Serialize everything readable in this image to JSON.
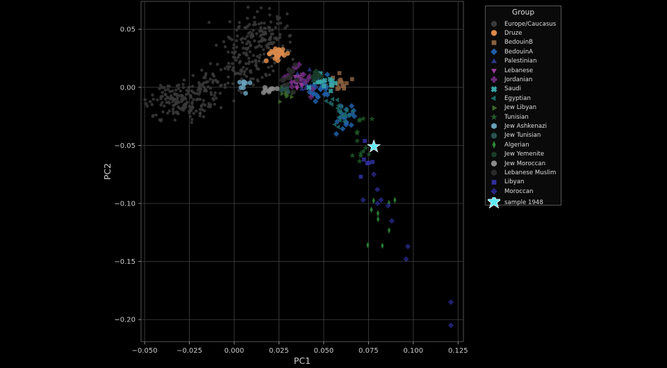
{
  "chart_data": {
    "type": "scatter",
    "xlabel": "PC1",
    "ylabel": "PC2",
    "xlim": [
      -0.052,
      0.128
    ],
    "ylim": [
      -0.219,
      0.074
    ],
    "xticks": [
      -0.05,
      -0.025,
      0.0,
      0.025,
      0.05,
      0.075,
      0.1,
      0.125
    ],
    "xtick_labels": [
      "−0.050",
      "−0.025",
      "0.000",
      "0.025",
      "0.050",
      "0.075",
      "0.100",
      "0.125"
    ],
    "yticks": [
      0.05,
      0.0,
      -0.05,
      -0.1,
      -0.15,
      -0.2
    ],
    "ytick_labels": [
      "0.05",
      "0.00",
      "−0.05",
      "−0.10",
      "−0.15",
      "−0.20"
    ],
    "grid": true,
    "legend": {
      "title": "Group",
      "placement": "outside-right"
    },
    "series": [
      {
        "name": "Europe/Caucasus",
        "marker": "circle",
        "color": "#3a3a3a",
        "clusters": [
          {
            "cx": 0.01,
            "cy": 0.04,
            "sx": 0.009,
            "sy": 0.012,
            "n": 140
          },
          {
            "cx": -0.03,
            "cy": -0.012,
            "sx": 0.011,
            "sy": 0.007,
            "n": 170
          },
          {
            "cx": -0.012,
            "cy": 0.002,
            "sx": 0.006,
            "sy": 0.008,
            "n": 50
          },
          {
            "cx": 0.005,
            "cy": 0.015,
            "sx": 0.006,
            "sy": 0.01,
            "n": 50
          },
          {
            "cx": 0.02,
            "cy": 0.045,
            "sx": 0.004,
            "sy": 0.008,
            "n": 30
          }
        ]
      },
      {
        "name": "Druze",
        "marker": "circle",
        "color": "#d98a4a",
        "clusters": [
          {
            "cx": 0.024,
            "cy": 0.029,
            "sx": 0.0025,
            "sy": 0.003,
            "n": 28
          }
        ]
      },
      {
        "name": "BedouinB",
        "marker": "square",
        "color": "#8a6040",
        "clusters": [
          {
            "cx": 0.059,
            "cy": 0.003,
            "sx": 0.003,
            "sy": 0.003,
            "n": 16
          }
        ]
      },
      {
        "name": "BedouinA",
        "marker": "diamond",
        "color": "#1f5fa8",
        "clusters": [
          {
            "cx": 0.046,
            "cy": -0.002,
            "sx": 0.004,
            "sy": 0.006,
            "n": 30
          },
          {
            "cx": 0.062,
            "cy": -0.026,
            "sx": 0.004,
            "sy": 0.006,
            "n": 18
          }
        ]
      },
      {
        "name": "Palestinian",
        "marker": "triangle-up",
        "color": "#2d3a8c",
        "clusters": [
          {
            "cx": 0.04,
            "cy": 0.004,
            "sx": 0.004,
            "sy": 0.004,
            "n": 18
          }
        ]
      },
      {
        "name": "Lebanese",
        "marker": "triangle-down",
        "color": "#9b3d9b",
        "clusters": [
          {
            "cx": 0.035,
            "cy": 0.006,
            "sx": 0.003,
            "sy": 0.004,
            "n": 14
          }
        ]
      },
      {
        "name": "Jordanian",
        "marker": "plus",
        "color": "#6b2a7a",
        "clusters": [
          {
            "cx": 0.038,
            "cy": 0.008,
            "sx": 0.004,
            "sy": 0.005,
            "n": 16
          }
        ]
      },
      {
        "name": "Saudi",
        "marker": "x",
        "color": "#3aa8a8",
        "clusters": [
          {
            "cx": 0.05,
            "cy": 0.003,
            "sx": 0.004,
            "sy": 0.005,
            "n": 14
          }
        ]
      },
      {
        "name": "Egyptian",
        "marker": "triangle-left",
        "color": "#1f6b6b",
        "clusters": [
          {
            "cx": 0.06,
            "cy": -0.02,
            "sx": 0.004,
            "sy": 0.008,
            "n": 24
          }
        ]
      },
      {
        "name": "Jew Libyan",
        "marker": "triangle-right",
        "color": "#3d6b2a",
        "clusters": [
          {
            "cx": 0.029,
            "cy": -0.006,
            "sx": 0.002,
            "sy": 0.003,
            "n": 10
          }
        ]
      },
      {
        "name": "Tunisian",
        "marker": "star",
        "color": "#1f5a2a",
        "clusters": [
          {
            "cx": 0.071,
            "cy": -0.045,
            "sx": 0.003,
            "sy": 0.012,
            "n": 14
          }
        ]
      },
      {
        "name": "Jew Ashkenazi",
        "marker": "hexagon",
        "color": "#6aa0b8",
        "clusters": [
          {
            "cx": 0.005,
            "cy": 0.003,
            "sx": 0.002,
            "sy": 0.002,
            "n": 10
          }
        ]
      },
      {
        "name": "Jew Tunisian",
        "marker": "circle",
        "color": "#2a5252",
        "clusters": [
          {
            "cx": 0.028,
            "cy": 0.0,
            "sx": 0.002,
            "sy": 0.002,
            "n": 8
          }
        ]
      },
      {
        "name": "Algerian",
        "marker": "thin-diamond",
        "color": "#2d8a3a",
        "clusters": [
          {
            "cx": 0.082,
            "cy": -0.115,
            "sx": 0.005,
            "sy": 0.025,
            "n": 9
          }
        ]
      },
      {
        "name": "Jew Yemenite",
        "marker": "pentagon",
        "color": "#1a3d2a",
        "clusters": [
          {
            "cx": 0.045,
            "cy": 0.01,
            "sx": 0.002,
            "sy": 0.003,
            "n": 10
          }
        ]
      },
      {
        "name": "Jew Moroccan",
        "marker": "circle",
        "color": "#8a8a8a",
        "clusters": [
          {
            "cx": 0.02,
            "cy": -0.002,
            "sx": 0.002,
            "sy": 0.002,
            "n": 8
          }
        ]
      },
      {
        "name": "Lebanese Muslim",
        "marker": "circle",
        "color": "#2a2a2a",
        "clusters": [
          {
            "cx": 0.032,
            "cy": 0.012,
            "sx": 0.004,
            "sy": 0.006,
            "n": 12
          }
        ]
      },
      {
        "name": "Libyan",
        "marker": "square",
        "color": "#3030a0",
        "clusters": [
          {
            "cx": 0.075,
            "cy": -0.065,
            "sx": 0.002,
            "sy": 0.008,
            "n": 6
          }
        ]
      },
      {
        "name": "Moroccan",
        "marker": "diamond",
        "color": "#262680",
        "points": [
          [
            0.078,
            -0.075
          ],
          [
            0.08,
            -0.088
          ],
          [
            0.082,
            -0.097
          ],
          [
            0.072,
            -0.097
          ],
          [
            0.086,
            -0.102
          ],
          [
            0.088,
            -0.115
          ],
          [
            0.097,
            -0.137
          ],
          [
            0.096,
            -0.148
          ],
          [
            0.121,
            -0.185
          ],
          [
            0.121,
            -0.205
          ],
          [
            0.08,
            -0.1
          ]
        ]
      },
      {
        "name": "sample 1948",
        "marker": "big-star",
        "color": "#5fe8f5",
        "points": [
          [
            0.078,
            -0.051
          ]
        ]
      }
    ]
  }
}
